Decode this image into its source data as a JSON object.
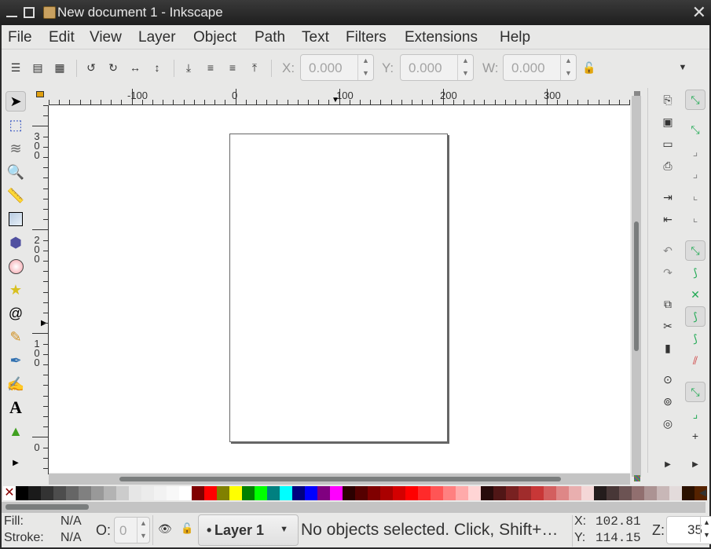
{
  "window": {
    "title": "New document 1 - Inkscape"
  },
  "menu": [
    "File",
    "Edit",
    "View",
    "Layer",
    "Object",
    "Path",
    "Text",
    "Filters",
    "Extensions",
    "Help"
  ],
  "controls": {
    "x_label": "X:",
    "x_value": "0.000",
    "y_label": "Y:",
    "y_value": "0.000",
    "w_label": "W:",
    "w_value": "0.000"
  },
  "ruler": {
    "h_labels": [
      "-100",
      "0",
      "100",
      "200",
      "300"
    ],
    "v_labels": [
      "300",
      "200",
      "100",
      "0"
    ]
  },
  "palette": [
    "#000000",
    "#1a1a1a",
    "#333333",
    "#4d4d4d",
    "#666666",
    "#808080",
    "#999999",
    "#b3b3b3",
    "#cccccc",
    "#e6e6e6",
    "#ececec",
    "#f2f2f2",
    "#f8f8f8",
    "#ffffff",
    "#800000",
    "#ff0000",
    "#808000",
    "#ffff00",
    "#008000",
    "#00ff00",
    "#008080",
    "#00ffff",
    "#000080",
    "#0000ff",
    "#800080",
    "#ff00ff",
    "#2b0000",
    "#550000",
    "#800000",
    "#aa0000",
    "#d40000",
    "#ff0000",
    "#ff2a2a",
    "#ff5555",
    "#ff8080",
    "#ffaaaa",
    "#ffd5d5",
    "#280b0b",
    "#501616",
    "#782121",
    "#a02c2c",
    "#c83737",
    "#d35f5f",
    "#de8787",
    "#e9afaf",
    "#f4d7d7",
    "#241c1c",
    "#483737",
    "#6c5353",
    "#916f6f",
    "#ac9393",
    "#c8b7b7",
    "#e3dbdb",
    "#2b1100",
    "#552200"
  ],
  "status": {
    "fill_label": "Fill:",
    "fill_value": "N/A",
    "stroke_label": "Stroke:",
    "stroke_value": "N/A",
    "opacity_label": "O:",
    "opacity_value": "0",
    "layer": "Layer 1",
    "message": "No objects selected. Click, Shift+…",
    "cursor_x_label": "X:",
    "cursor_x": "102.81",
    "cursor_y_label": "Y:",
    "cursor_y": "114.15",
    "zoom_label": "Z:",
    "zoom_value": "35"
  }
}
